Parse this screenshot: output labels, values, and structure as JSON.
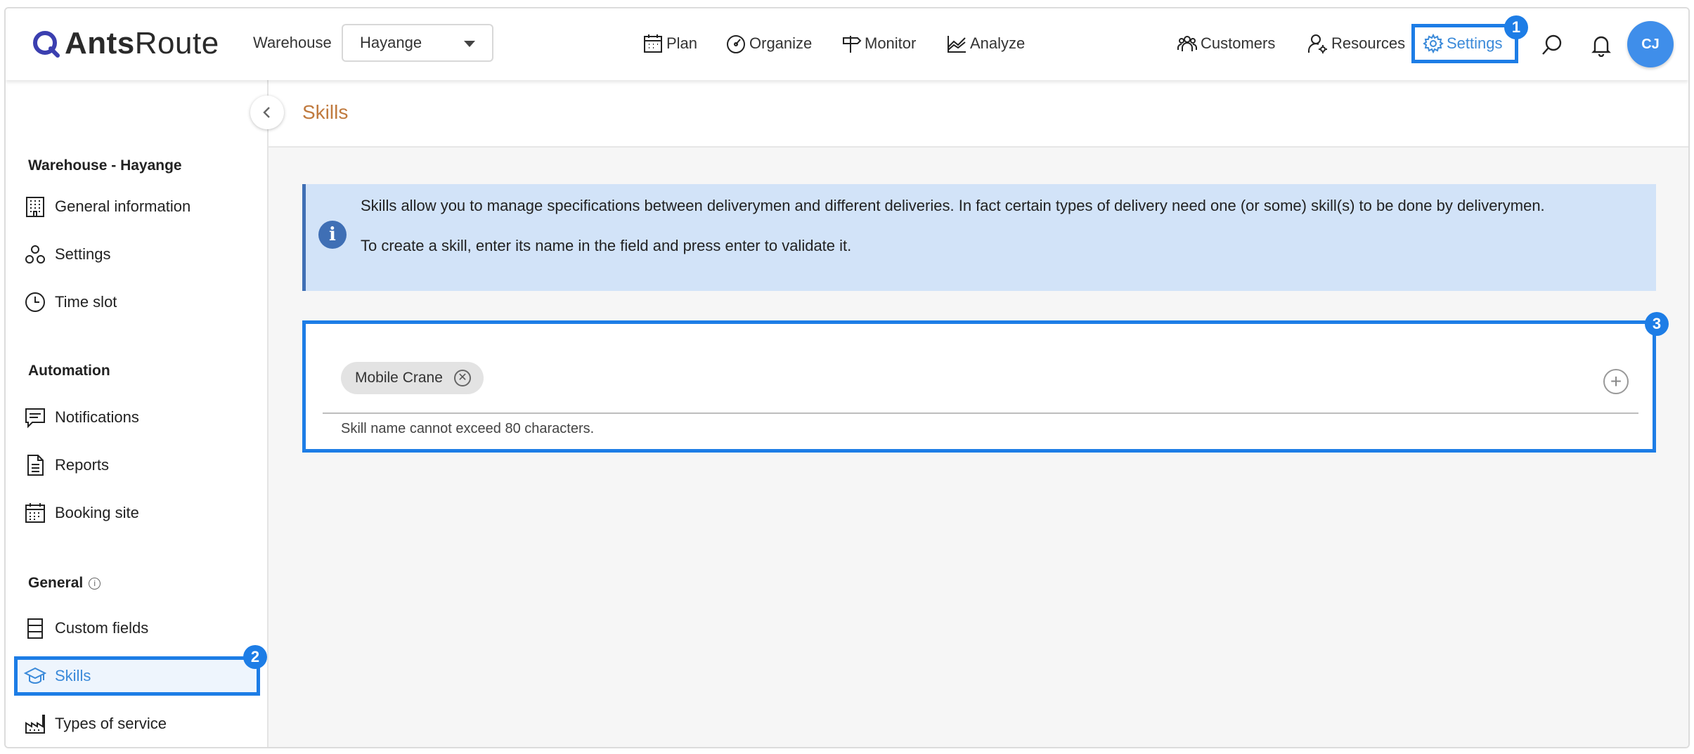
{
  "header": {
    "logo": {
      "bold": "Ants",
      "light": "Route"
    },
    "warehouse_label": "Warehouse",
    "warehouse_value": "Hayange",
    "nav": [
      {
        "label": "Plan",
        "icon": "calendar-icon"
      },
      {
        "label": "Organize",
        "icon": "speedometer-icon"
      },
      {
        "label": "Monitor",
        "icon": "signpost-icon"
      },
      {
        "label": "Analyze",
        "icon": "chart-icon"
      }
    ],
    "customers_label": "Customers",
    "resources_label": "Resources",
    "settings_label": "Settings",
    "avatar_initials": "CJ",
    "accent_color": "#1d7de6"
  },
  "annotations": {
    "badge1": "1",
    "badge2": "2",
    "badge3": "3"
  },
  "sidebar": {
    "section_warehouse": "Warehouse - Hayange",
    "items_warehouse": [
      "General information",
      "Settings",
      "Time slot"
    ],
    "section_automation": "Automation",
    "items_automation": [
      "Notifications",
      "Reports",
      "Booking site"
    ],
    "section_general": "General",
    "items_general": [
      "Custom fields",
      "Skills",
      "Types of service"
    ]
  },
  "main": {
    "title": "Skills",
    "info_line1": "Skills allow you to manage specifications between deliverymen and different deliveries. In fact certain types of delivery need one (or some) skill(s) to be done by deliverymen.",
    "info_line2": "To create a skill, enter its name in the field and press enter to validate it.",
    "skills": [
      "Mobile Crane"
    ],
    "hint": "Skill name cannot exceed 80 characters."
  }
}
